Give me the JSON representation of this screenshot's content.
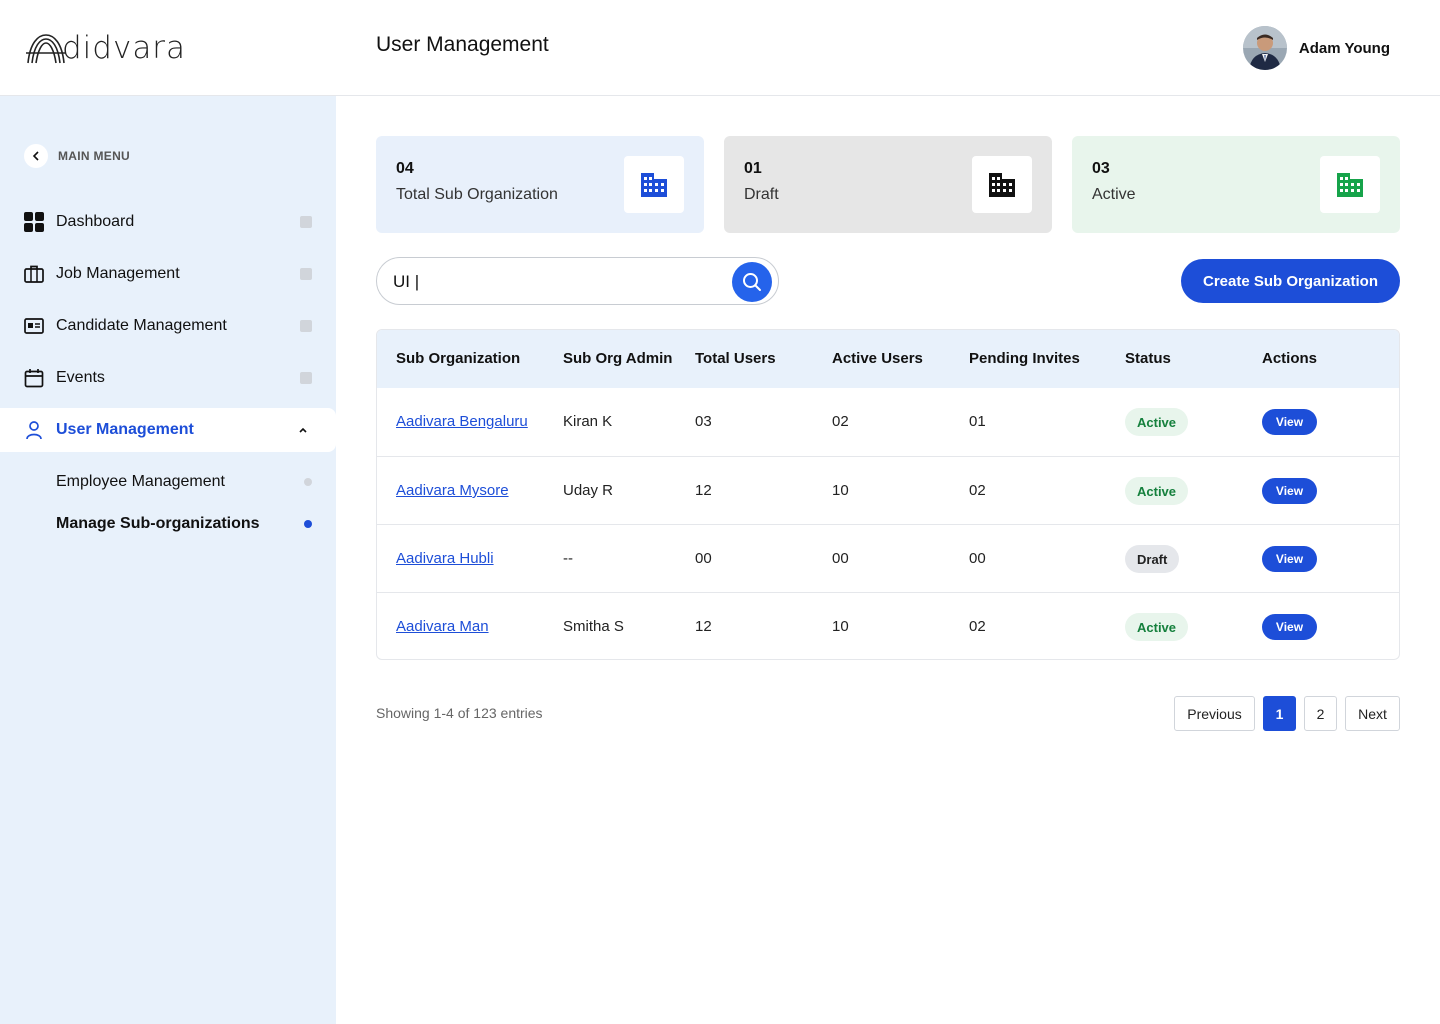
{
  "brand": {
    "logo_text": "didvara"
  },
  "header": {
    "title": "User Management",
    "user_name": "Adam Young"
  },
  "sidebar": {
    "menu_label": "MAIN MENU",
    "items": [
      {
        "label": "Dashboard",
        "icon": "grid-icon"
      },
      {
        "label": "Job Management",
        "icon": "briefcase-icon"
      },
      {
        "label": "Candidate Management",
        "icon": "id-card-icon"
      },
      {
        "label": "Events",
        "icon": "calendar-icon"
      },
      {
        "label": "User Management",
        "icon": "user-icon"
      }
    ],
    "sub_items": [
      {
        "label": "Employee Management"
      },
      {
        "label": "Manage Sub-organizations"
      }
    ]
  },
  "stats": [
    {
      "count": "04",
      "label": "Total Sub Organization",
      "icon_color": "#1d4ed8",
      "bg": "#e8f0fb"
    },
    {
      "count": "01",
      "label": "Draft",
      "icon_color": "#111111",
      "bg": "#e6e6e6"
    },
    {
      "count": "03",
      "label": "Active",
      "icon_color": "#16a34a",
      "bg": "#e8f5ec"
    }
  ],
  "search": {
    "value": "UI |"
  },
  "create_button": "Create Sub Organization",
  "table": {
    "headers": [
      "Sub Organization",
      "Sub Org Admin",
      "Total Users",
      "Active Users",
      "Pending Invites",
      "Status",
      "Actions"
    ],
    "rows": [
      {
        "name": "Aadivara Bengaluru",
        "admin": "Kiran K",
        "total": "03",
        "active": "02",
        "pending": "01",
        "status": "Active",
        "action": "View"
      },
      {
        "name": "Aadivara Mysore",
        "admin": "Uday R",
        "total": "12",
        "active": "10",
        "pending": "02",
        "status": "Active",
        "action": "View"
      },
      {
        "name": "Aadivara Hubli",
        "admin": "--",
        "total": "00",
        "active": "00",
        "pending": "00",
        "status": "Draft",
        "action": "View"
      },
      {
        "name": "Aadivara Man",
        "admin": "Smitha S",
        "total": "12",
        "active": "10",
        "pending": "02",
        "status": "Active",
        "action": "View"
      }
    ]
  },
  "pagination": {
    "summary": "Showing 1-4 of 123 entries",
    "previous": "Previous",
    "pages": [
      "1",
      "2"
    ],
    "next": "Next"
  },
  "colors": {
    "accent": "#1d4ed8",
    "sidebar_bg": "#e8f1fb",
    "active_green": "#15803d"
  }
}
